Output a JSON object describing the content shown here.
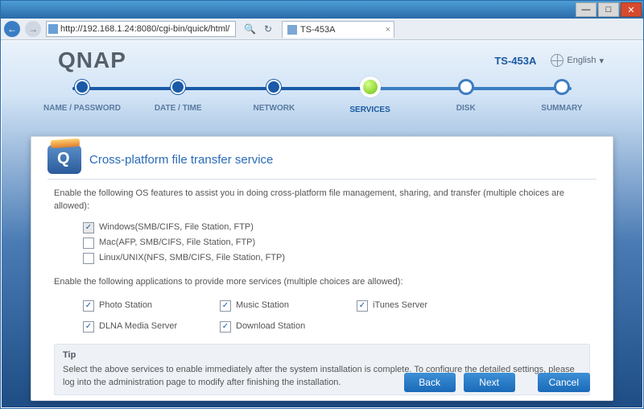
{
  "window": {
    "url": "http://192.168.1.24:8080/cgi-bin/quick/html/",
    "tab_title": "TS-453A"
  },
  "header": {
    "brand": "QNAP",
    "model": "TS-453A",
    "language_label": "English",
    "language_caret": "▾"
  },
  "stepper": {
    "steps": [
      {
        "label": "NAME / PASSWORD",
        "state": "done"
      },
      {
        "label": "DATE / TIME",
        "state": "done"
      },
      {
        "label": "NETWORK",
        "state": "done"
      },
      {
        "label": "SERVICES",
        "state": "current"
      },
      {
        "label": "DISK",
        "state": "future"
      },
      {
        "label": "SUMMARY",
        "state": "future"
      }
    ]
  },
  "panel": {
    "title": "Cross-platform file transfer service",
    "intro": "Enable the following OS features to assist you in doing cross-platform file management, sharing, and transfer (multiple choices are allowed):",
    "os_options": [
      {
        "label": "Windows(SMB/CIFS, File Station, FTP)",
        "checked": true,
        "disabled": true
      },
      {
        "label": "Mac(AFP, SMB/CIFS, File Station, FTP)",
        "checked": false,
        "disabled": false
      },
      {
        "label": "Linux/UNIX(NFS, SMB/CIFS, File Station, FTP)",
        "checked": false,
        "disabled": false
      }
    ],
    "apps_intro": "Enable the following applications to provide more services (multiple choices are allowed):",
    "apps": [
      {
        "label": "Photo Station",
        "checked": true
      },
      {
        "label": "Music Station",
        "checked": true
      },
      {
        "label": "iTunes Server",
        "checked": true
      },
      {
        "label": "DLNA Media Server",
        "checked": true
      },
      {
        "label": "Download Station",
        "checked": true
      }
    ],
    "tip_title": "Tip",
    "tip_body": "Select the above services to enable immediately after the system installation is complete. To configure the detailed settings, please log into the administration page to modify after finishing the installation."
  },
  "buttons": {
    "back": "Back",
    "next": "Next",
    "cancel": "Cancel"
  }
}
